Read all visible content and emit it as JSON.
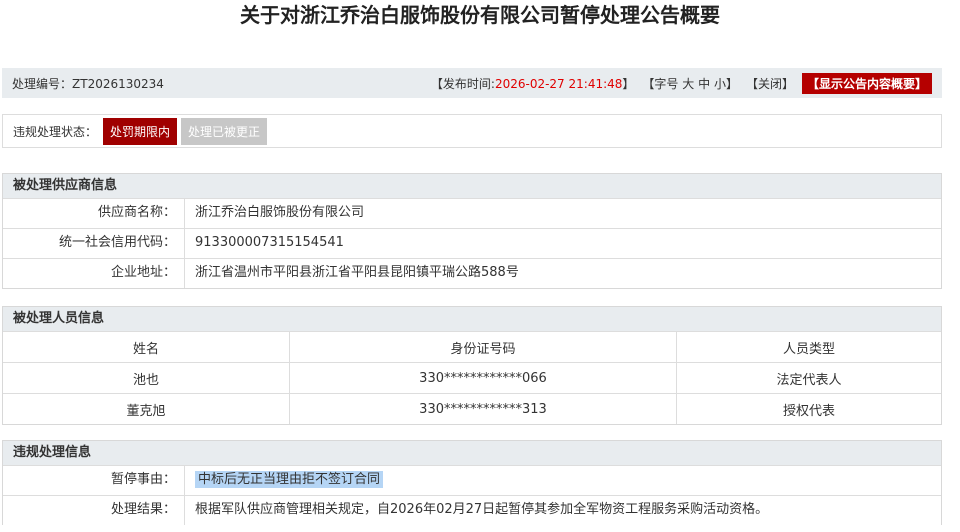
{
  "title": "关于对浙江乔治白服饰股份有限公司暂停处理公告概要",
  "info": {
    "number_label": "处理编号：",
    "number": "ZT2026130234",
    "publish_prefix": "【发布时间:",
    "publish_time": "2026-02-27 21:41:48",
    "publish_suffix": "】",
    "font_label": "【字号",
    "font_large": "大",
    "font_medium": "中",
    "font_small": "小】",
    "close": "【关闭】",
    "show_summary": "【显示公告内容概要】"
  },
  "status": {
    "label": "违规处理状态：",
    "active": "处罚期限内",
    "inactive": "处理已被更正"
  },
  "supplier": {
    "heading": "被处理供应商信息",
    "rows": [
      {
        "k": "供应商名称：",
        "v": "浙江乔治白服饰股份有限公司"
      },
      {
        "k": "统一社会信用代码：",
        "v": "913300007315154541"
      },
      {
        "k": "企业地址：",
        "v": "浙江省温州市平阳县浙江省平阳县昆阳镇平瑞公路588号"
      }
    ]
  },
  "persons": {
    "heading": "被处理人员信息",
    "columns": [
      "姓名",
      "身份证号码",
      "人员类型"
    ],
    "rows": [
      [
        "池也",
        "330************066",
        "法定代表人"
      ],
      [
        "董克旭",
        "330************313",
        "授权代表"
      ]
    ]
  },
  "violation": {
    "heading": "违规处理信息",
    "reason_label": "暂停事由：",
    "reason": "中标后无正当理由拒不签订合同",
    "result_label": "处理结果：",
    "result": "根据军队供应商管理相关规定，自2026年02月27日起暂停其参加全军物资工程服务采购活动资格。"
  }
}
